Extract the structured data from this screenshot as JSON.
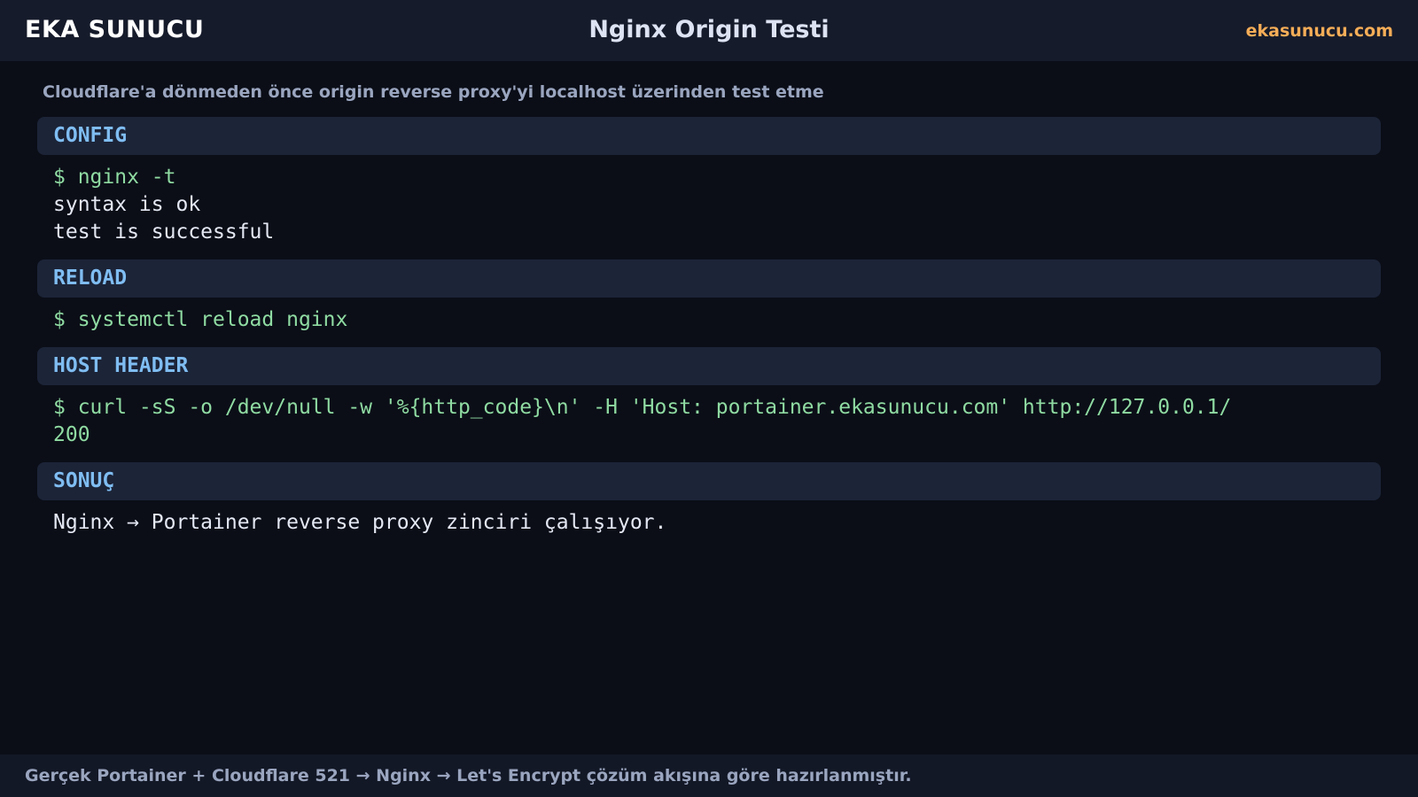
{
  "header": {
    "brand": "EKA SUNUCU",
    "title": "Nginx Origin Testi",
    "site": "ekasunucu.com"
  },
  "subtitle": "Cloudflare'a dönmeden önce origin reverse proxy'yi localhost üzerinden test etme",
  "sections": [
    {
      "title": "CONFIG",
      "lines": [
        {
          "text": "$ nginx -t",
          "kind": "command"
        },
        {
          "text": "syntax is ok",
          "kind": "output"
        },
        {
          "text": "test is successful",
          "kind": "output"
        }
      ]
    },
    {
      "title": "RELOAD",
      "lines": [
        {
          "text": "$ systemctl reload nginx",
          "kind": "command"
        }
      ]
    },
    {
      "title": "HOST HEADER",
      "lines": [
        {
          "text": "$ curl -sS -o /dev/null -w '%{http_code}\\n' -H 'Host: portainer.ekasunucu.com' http://127.0.0.1/",
          "kind": "command"
        },
        {
          "text": "200",
          "kind": "command"
        }
      ]
    },
    {
      "title": "SONUÇ",
      "lines": [
        {
          "text": "Nginx → Portainer reverse proxy zinciri çalışıyor.",
          "kind": "output"
        }
      ]
    }
  ],
  "footer": "Gerçek Portainer + Cloudflare 521 → Nginx → Let's Encrypt çözüm akışına göre hazırlanmıştır.",
  "colors": {
    "background": "#0b0e17",
    "bar": "#161b2b",
    "section_header": "#1c2438",
    "section_title": "#7fbdf2",
    "command": "#8fdba2",
    "output": "#e4e8f3",
    "accent": "#f5ad57",
    "muted": "#9aa5bf"
  }
}
